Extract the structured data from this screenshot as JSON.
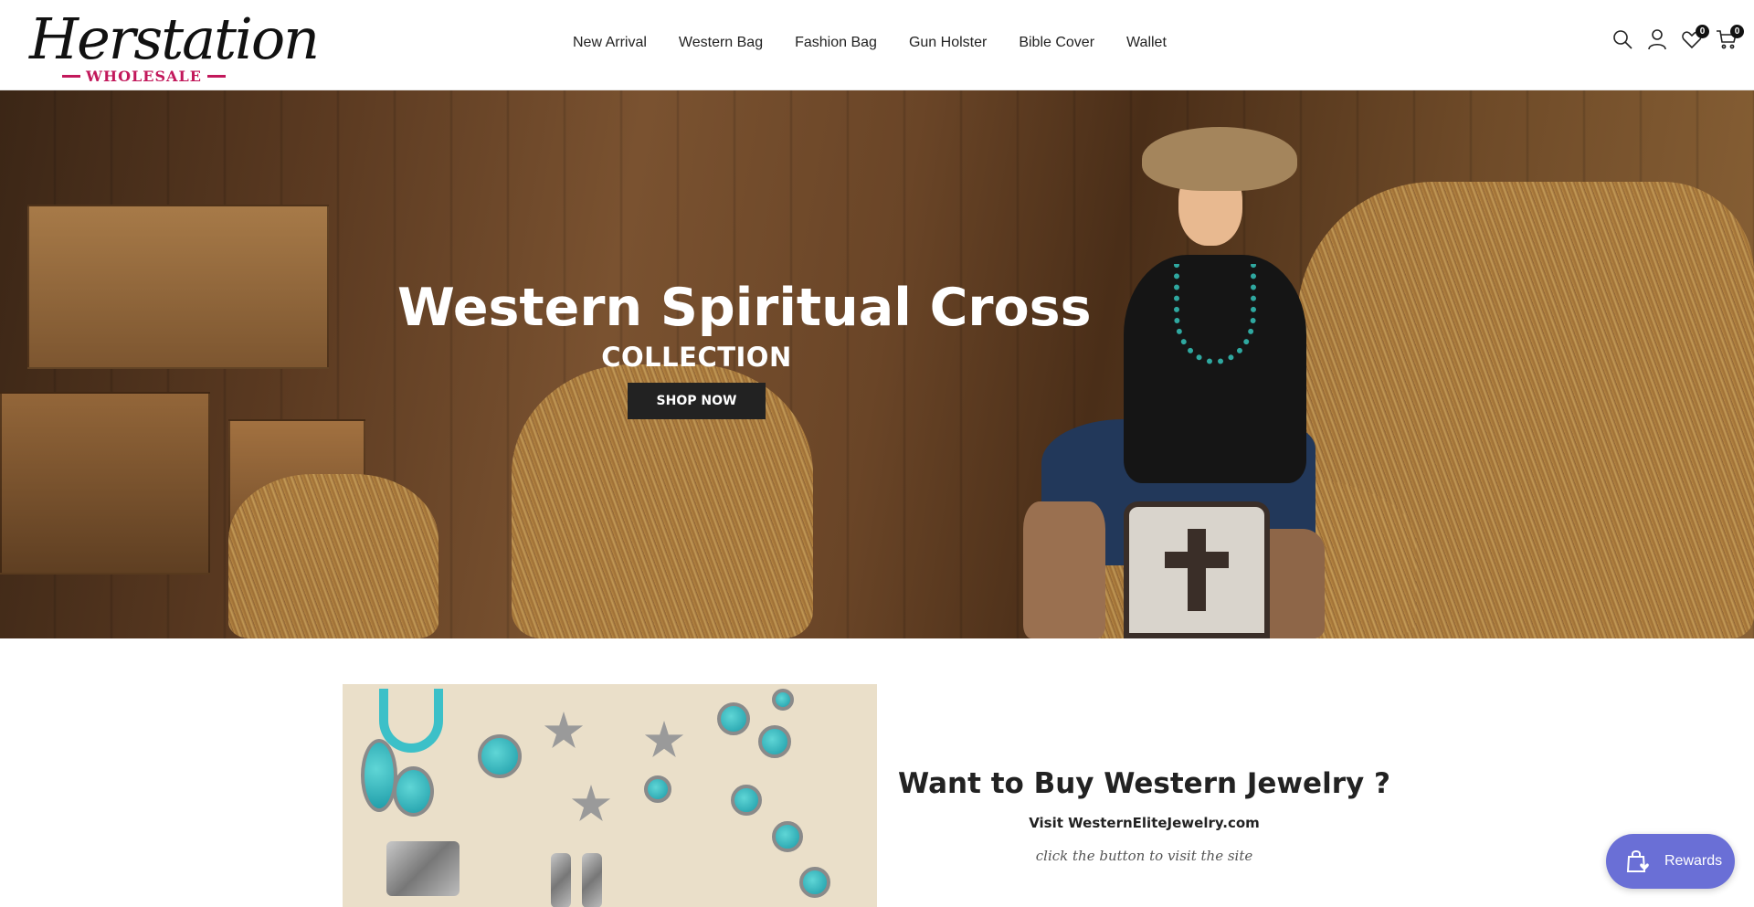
{
  "brand": {
    "name": "Herstation",
    "subtitle": "WHOLESALE",
    "accent_color": "#c2185b"
  },
  "nav": {
    "items": [
      {
        "label": "New Arrival"
      },
      {
        "label": "Western Bag"
      },
      {
        "label": "Fashion Bag"
      },
      {
        "label": "Gun Holster"
      },
      {
        "label": "Bible Cover"
      },
      {
        "label": "Wallet"
      }
    ]
  },
  "header_icons": {
    "search": "search-icon",
    "account": "user-icon",
    "wishlist": {
      "icon": "heart-icon",
      "count": "0"
    },
    "cart": {
      "icon": "cart-icon",
      "count": "0"
    }
  },
  "hero": {
    "title": "Western Spiritual Cross",
    "subtitle": "COLLECTION",
    "button_label": "SHOP NOW"
  },
  "promo": {
    "title": "Want to Buy Western Jewelry ?",
    "visit_text": "Visit WesternEliteJewelry.com",
    "note": "click the button to visit the site"
  },
  "rewards": {
    "label": "Rewards",
    "icon": "shopping-bag-heart-icon",
    "color": "#6a6fd6"
  }
}
